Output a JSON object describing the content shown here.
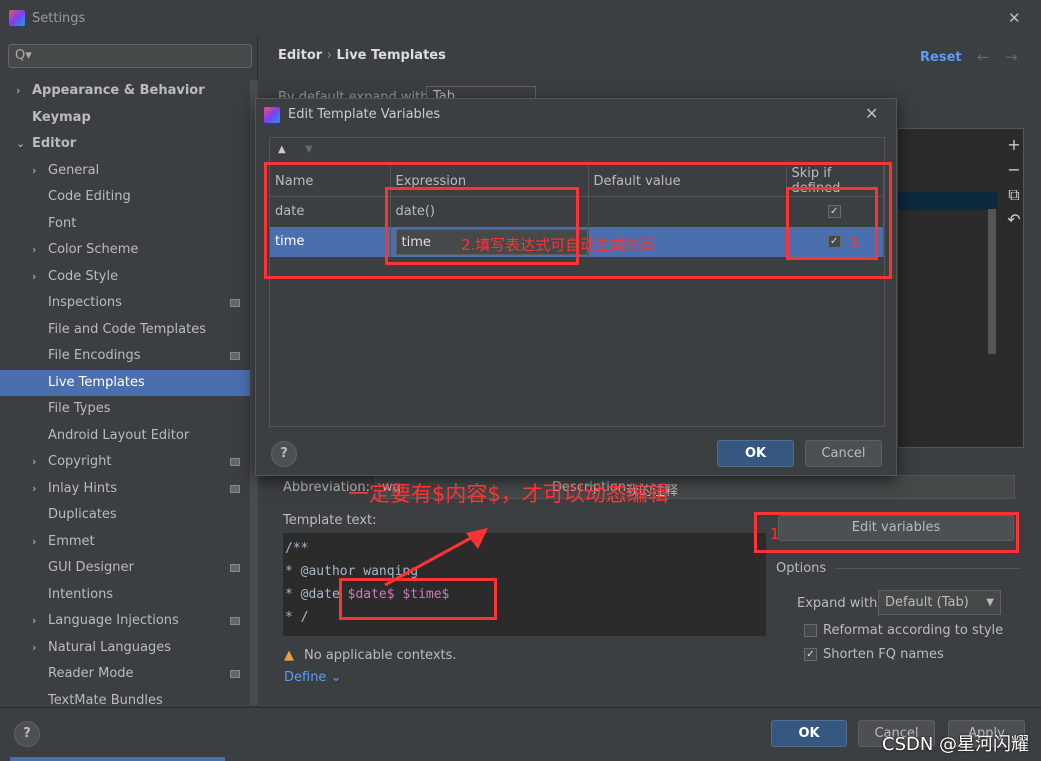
{
  "window": {
    "title": "Settings",
    "close": "✕"
  },
  "search": {
    "placeholder": "Q▾"
  },
  "sidebar": {
    "items": [
      {
        "label": "Appearance & Behavior",
        "level": 0,
        "chevron": "›",
        "bold": true
      },
      {
        "label": "Keymap",
        "level": 0,
        "bold": true
      },
      {
        "label": "Editor",
        "level": 0,
        "chevron": "⌄",
        "bold": true
      },
      {
        "label": "General",
        "level": 1,
        "chevron": "›"
      },
      {
        "label": "Code Editing",
        "level": 1
      },
      {
        "label": "Font",
        "level": 1
      },
      {
        "label": "Color Scheme",
        "level": 1,
        "chevron": "›"
      },
      {
        "label": "Code Style",
        "level": 1,
        "chevron": "›"
      },
      {
        "label": "Inspections",
        "level": 1,
        "badge": true
      },
      {
        "label": "File and Code Templates",
        "level": 1
      },
      {
        "label": "File Encodings",
        "level": 1,
        "badge": true
      },
      {
        "label": "Live Templates",
        "level": 1,
        "selected": true
      },
      {
        "label": "File Types",
        "level": 1
      },
      {
        "label": "Android Layout Editor",
        "level": 1
      },
      {
        "label": "Copyright",
        "level": 1,
        "chevron": "›",
        "badge": true
      },
      {
        "label": "Inlay Hints",
        "level": 1,
        "chevron": "›",
        "badge": true
      },
      {
        "label": "Duplicates",
        "level": 1
      },
      {
        "label": "Emmet",
        "level": 1,
        "chevron": "›"
      },
      {
        "label": "GUI Designer",
        "level": 1,
        "badge": true
      },
      {
        "label": "Intentions",
        "level": 1
      },
      {
        "label": "Language Injections",
        "level": 1,
        "chevron": "›",
        "badge": true
      },
      {
        "label": "Natural Languages",
        "level": 1,
        "chevron": "›"
      },
      {
        "label": "Reader Mode",
        "level": 1,
        "badge": true
      },
      {
        "label": "TextMate Bundles",
        "level": 1
      }
    ]
  },
  "breadcrumb": {
    "parent": "Editor",
    "sep": "›",
    "current": "Live Templates"
  },
  "header": {
    "reset": "Reset",
    "back": "←",
    "forward": "→"
  },
  "expand_default": {
    "label": "By default expand with",
    "value": "Tab"
  },
  "side_tools": [
    "+",
    "−",
    "⧉",
    "↶"
  ],
  "dialog": {
    "title": "Edit Template Variables",
    "close": "✕",
    "up": "▲",
    "down": "▼",
    "columns": [
      "Name",
      "Expression",
      "Default value",
      "Skip if defined"
    ],
    "rows": [
      {
        "name": "date",
        "expression": "date()",
        "default": "",
        "skip": true
      },
      {
        "name": "time",
        "expression": "time",
        "default": "",
        "skip": true,
        "selected": true
      }
    ],
    "help": "?",
    "ok": "OK",
    "cancel": "Cancel"
  },
  "template": {
    "abbreviation_label": "Abbreviation:",
    "abbreviation": "wq",
    "description_label": "Description:",
    "description": "我的注释",
    "text_label": "Template text:",
    "lines": [
      "/**",
      "* @author wanqing",
      "* @date ",
      "* /"
    ],
    "vars": "$date$ $time$",
    "edit_variables": "Edit variables",
    "warning": "No applicable contexts.",
    "define": "Define ⌄"
  },
  "options": {
    "title": "Options",
    "expand_label": "Expand with",
    "expand_value": "Default (Tab)",
    "reformat": {
      "label": "Reformat according to style",
      "checked": false
    },
    "shorten": {
      "label": "Shorten FQ names",
      "checked": true
    }
  },
  "annotations": {
    "a1": "1",
    "a2": "2.填写表达式可自动生成时间",
    "a3": "3",
    "main": "一定要有$内容$，才可以动态编辑"
  },
  "footer": {
    "help": "?",
    "ok": "OK",
    "cancel": "Cancel",
    "apply": "Apply",
    "watermark": "CSDN @星河闪耀"
  },
  "colors": {
    "accent": "#4b6eaf",
    "annotation": "#ff3333",
    "link": "#589df6"
  }
}
